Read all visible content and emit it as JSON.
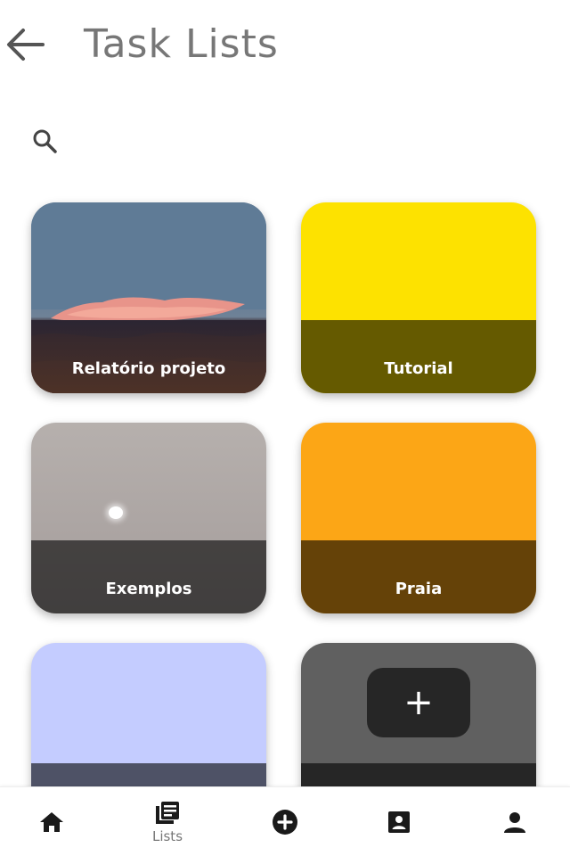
{
  "header": {
    "title": "Task Lists",
    "back_icon": "arrow-left-icon"
  },
  "search": {
    "icon": "search-icon"
  },
  "cards": [
    {
      "label": "Relatório projeto",
      "color": "#5f7b96",
      "image": "cloud-sky-photo"
    },
    {
      "label": "Tutorial",
      "color": "#fde200"
    },
    {
      "label": "Exemplos",
      "color": "#aca5a3",
      "image": "hazy-sun-photo"
    },
    {
      "label": "Praia",
      "color": "#fca616"
    },
    {
      "label": "",
      "color": "#c4ccff"
    },
    {
      "label": "",
      "color": "#606060"
    }
  ],
  "add_button": {
    "label": "+",
    "icon": "plus-icon"
  },
  "bottom_nav": {
    "items": [
      {
        "icon": "home-icon",
        "label": ""
      },
      {
        "icon": "lists-icon",
        "label": "Lists",
        "active": true
      },
      {
        "icon": "add-circle-icon",
        "label": ""
      },
      {
        "icon": "contact-card-icon",
        "label": ""
      },
      {
        "icon": "person-icon",
        "label": ""
      }
    ]
  },
  "colors": {
    "title": "#777777",
    "nav_icon": "#1a1a1a",
    "overlay": "rgba(0,0,0,0.6)"
  }
}
